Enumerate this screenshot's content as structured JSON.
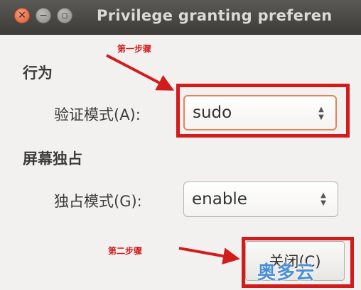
{
  "window": {
    "title": "Privilege granting preferen",
    "buttons": [
      "close-icon",
      "minimize-icon",
      "maximize-icon"
    ]
  },
  "sections": {
    "behavior": {
      "heading": "行为",
      "auth_mode_label": "验证模式(A):",
      "auth_mode_value": "sudo"
    },
    "exclusive": {
      "heading": "屏幕独占",
      "exclusive_mode_label": "独占模式(G):",
      "exclusive_mode_value": "enable"
    }
  },
  "footer": {
    "close_button_label": "关闭(C)"
  },
  "annotations": {
    "step1": "第一步骤",
    "step2": "第二步骤",
    "color": "#d21c1c"
  },
  "watermark": "奥多云"
}
